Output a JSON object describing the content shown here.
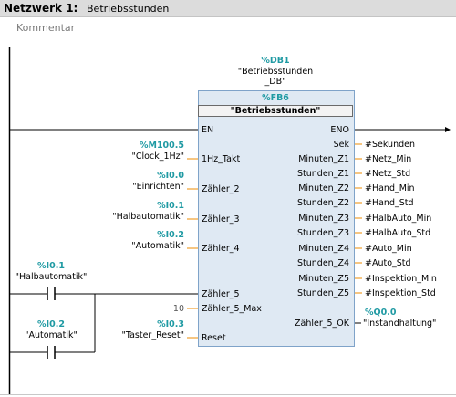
{
  "header": {
    "network_label": "Netzwerk 1:",
    "network_title": "Betriebsstunden"
  },
  "comment_placeholder": "Kommentar",
  "db": {
    "address": "%DB1",
    "name_line1": "\"Betriebsstunden",
    "name_line2": "_DB\""
  },
  "fb": {
    "address": "%FB6",
    "name": "\"Betriebsstunden\""
  },
  "en_label": "EN",
  "eno_label": "ENO",
  "inputs": [
    {
      "pin": "1Hz_Takt",
      "address": "%M100.5",
      "symbol": "\"Clock_1Hz\""
    },
    {
      "pin": "Zähler_2",
      "address": "%I0.0",
      "symbol": "\"Einrichten\""
    },
    {
      "pin": "Zähler_3",
      "address": "%I0.1",
      "symbol": "\"Halbautomatik\""
    },
    {
      "pin": "Zähler_4",
      "address": "%I0.2",
      "symbol": "\"Automatik\""
    },
    {
      "pin": "Zähler_5",
      "address": "",
      "symbol": ""
    },
    {
      "pin": "Zähler_5_Max",
      "address": "",
      "symbol": "10"
    },
    {
      "pin": "Reset",
      "address": "%I0.3",
      "symbol": "\"Taster_Reset\""
    }
  ],
  "outputs": [
    {
      "pin": "Sek",
      "value": "#Sekunden"
    },
    {
      "pin": "Minuten_Z1",
      "value": "#Netz_Min"
    },
    {
      "pin": "Stunden_Z1",
      "value": "#Netz_Std"
    },
    {
      "pin": "Minuten_Z2",
      "value": "#Hand_Min"
    },
    {
      "pin": "Stunden_Z2",
      "value": "#Hand_Std"
    },
    {
      "pin": "Minuten_Z3",
      "value": "#HalbAuto_Min"
    },
    {
      "pin": "Stunden_Z3",
      "value": "#HalbAuto_Std"
    },
    {
      "pin": "Minuten_Z4",
      "value": "#Auto_Min"
    },
    {
      "pin": "Stunden_Z4",
      "value": "#Auto_Std"
    },
    {
      "pin": "Minuten_Z5",
      "value": "#Inspektion_Min"
    },
    {
      "pin": "Stunden_Z5",
      "value": "#Inspektion_Std"
    }
  ],
  "ok_output": {
    "pin": "Zähler_5_OK",
    "address": "%Q0.0",
    "symbol": "\"Instandhaltung\""
  },
  "contacts": [
    {
      "address": "%I0.1",
      "symbol": "\"Halbautomatik\""
    },
    {
      "address": "%I0.2",
      "symbol": "\"Automatik\""
    }
  ],
  "colors": {
    "address": "#1f9aa3",
    "block_fill": "#dfe9f3",
    "block_border": "#7fa3c9",
    "wire_stub": "#f0a030"
  }
}
